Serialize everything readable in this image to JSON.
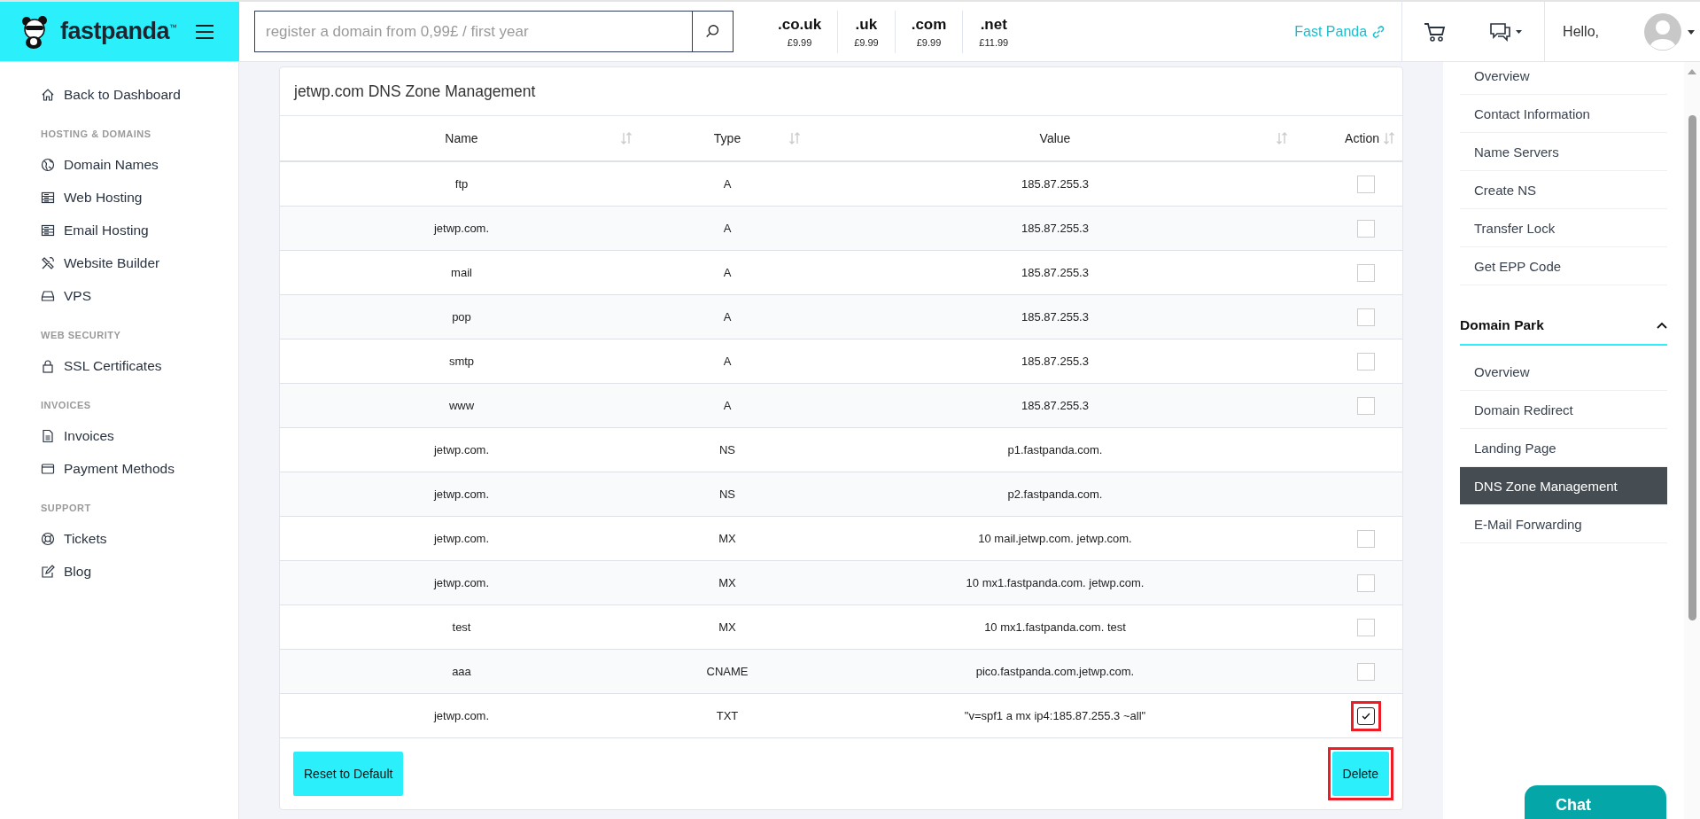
{
  "header": {
    "logo": "fastpanda",
    "logo_mark": "™",
    "search": {
      "placeholder": "register a domain from 0,99£ / first year"
    },
    "tlds": [
      {
        "name": ".co.uk",
        "price": "£9.99"
      },
      {
        "name": ".uk",
        "price": "£9.99"
      },
      {
        "name": ".com",
        "price": "£9.99"
      },
      {
        "name": ".net",
        "price": "£11.99"
      }
    ],
    "site_link": "Fast Panda",
    "greeting": "Hello,"
  },
  "sidebar": {
    "sections": [
      {
        "items": [
          {
            "label": "Back to Dashboard"
          }
        ]
      },
      {
        "title": "HOSTING & DOMAINS",
        "items": [
          {
            "label": "Domain Names"
          },
          {
            "label": "Web Hosting"
          },
          {
            "label": "Email Hosting"
          },
          {
            "label": "Website Builder"
          },
          {
            "label": "VPS"
          }
        ]
      },
      {
        "title": "WEB SECURITY",
        "items": [
          {
            "label": "SSL Certificates"
          }
        ]
      },
      {
        "title": "INVOICES",
        "items": [
          {
            "label": "Invoices"
          },
          {
            "label": "Payment Methods"
          }
        ]
      },
      {
        "title": "SUPPORT",
        "items": [
          {
            "label": "Tickets"
          },
          {
            "label": "Blog"
          }
        ]
      }
    ]
  },
  "card": {
    "title": "jetwp.com DNS Zone Management",
    "columns": [
      "Name",
      "Type",
      "Value",
      "Action"
    ],
    "rows": [
      {
        "name": "ftp",
        "type": "A",
        "value": "185.87.255.3",
        "kind": "checkbox",
        "checked": false,
        "highlighted": false
      },
      {
        "name": "jetwp.com.",
        "type": "A",
        "value": "185.87.255.3",
        "kind": "checkbox",
        "checked": false,
        "highlighted": false
      },
      {
        "name": "mail",
        "type": "A",
        "value": "185.87.255.3",
        "kind": "checkbox",
        "checked": false,
        "highlighted": false
      },
      {
        "name": "pop",
        "type": "A",
        "value": "185.87.255.3",
        "kind": "checkbox",
        "checked": false,
        "highlighted": false
      },
      {
        "name": "smtp",
        "type": "A",
        "value": "185.87.255.3",
        "kind": "checkbox",
        "checked": false,
        "highlighted": false
      },
      {
        "name": "www",
        "type": "A",
        "value": "185.87.255.3",
        "kind": "checkbox",
        "checked": false,
        "highlighted": false
      },
      {
        "name": "jetwp.com.",
        "type": "NS",
        "value": "p1.fastpanda.com.",
        "kind": "plain"
      },
      {
        "name": "jetwp.com.",
        "type": "NS",
        "value": "p2.fastpanda.com.",
        "kind": "plain"
      },
      {
        "name": "jetwp.com.",
        "type": "MX",
        "value": "10 mail.jetwp.com. jetwp.com.",
        "kind": "checkbox",
        "checked": false,
        "highlighted": false
      },
      {
        "name": "jetwp.com.",
        "type": "MX",
        "value": "10 mx1.fastpanda.com. jetwp.com.",
        "kind": "checkbox",
        "checked": false,
        "highlighted": false
      },
      {
        "name": "test",
        "type": "MX",
        "value": "10 mx1.fastpanda.com. test",
        "kind": "checkbox",
        "checked": false,
        "highlighted": false
      },
      {
        "name": "aaa",
        "type": "CNAME",
        "value": "pico.fastpanda.com.jetwp.com.",
        "kind": "checkbox",
        "checked": false,
        "highlighted": false
      },
      {
        "name": "jetwp.com.",
        "type": "TXT",
        "value": "\"v=spf1 a mx ip4:185.87.255.3 ~all\"",
        "kind": "checkbox",
        "checked": true,
        "highlighted": true
      }
    ],
    "buttons": [
      {
        "label": "Reset to Default",
        "highlighted": false
      },
      {
        "label": "Delete",
        "highlighted": true
      }
    ]
  },
  "right_panel": {
    "groups": [
      {
        "items": [
          {
            "label": "Overview",
            "selected": false
          },
          {
            "label": "Contact Information",
            "selected": false
          },
          {
            "label": "Name Servers",
            "selected": false
          },
          {
            "label": "Create NS",
            "selected": false
          },
          {
            "label": "Transfer Lock",
            "selected": false
          },
          {
            "label": "Get EPP Code",
            "selected": false
          }
        ]
      },
      {
        "title": "Domain Park",
        "expanded": true,
        "items": [
          {
            "label": "Overview",
            "selected": false
          },
          {
            "label": "Domain Redirect",
            "selected": false
          },
          {
            "label": "Landing Page",
            "selected": false
          },
          {
            "label": "DNS Zone Management",
            "selected": true
          },
          {
            "label": "E-Mail Forwarding",
            "selected": false
          }
        ]
      }
    ]
  },
  "chat": {
    "label": "Chat"
  }
}
